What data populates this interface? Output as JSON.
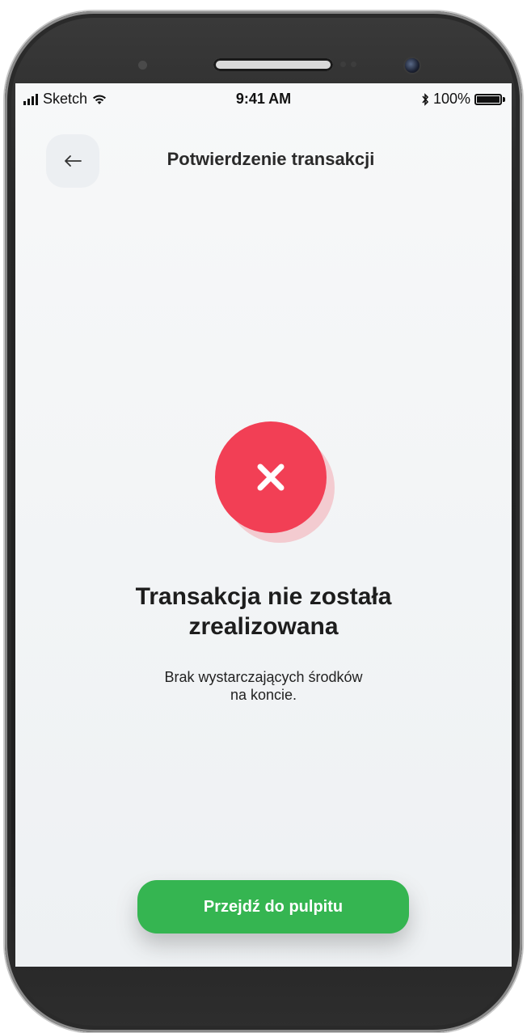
{
  "status_bar": {
    "carrier": "Sketch",
    "time": "9:41 AM",
    "battery": "100%"
  },
  "header": {
    "title": "Potwierdzenie transakcji",
    "back_icon": "arrow-left-icon"
  },
  "result": {
    "icon": "close-icon",
    "icon_color": "#f23f55",
    "headline_line1": "Transakcja nie została",
    "headline_line2": "zrealizowana",
    "message_line1": "Brak wystarczających środków",
    "message_line2": "na koncie."
  },
  "cta": {
    "label": "Przejdź do pulpitu",
    "color": "#35b551"
  }
}
